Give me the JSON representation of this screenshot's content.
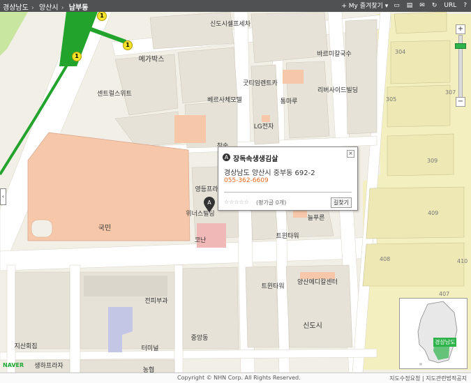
{
  "breadcrumb": {
    "items": [
      "경상남도",
      "양산시",
      "남부동"
    ]
  },
  "toolbar": {
    "my_favorites": "My 즐겨찾기",
    "url": "URL",
    "help": "?"
  },
  "colors": {
    "road": "#ffffff",
    "block": "#e6e2d8",
    "land": "#f2efe6",
    "highlight_block": "#f6c7a8",
    "selected_block": "#f1b8b8",
    "green_zone": "#c8e6a0",
    "subway": "#22a32c",
    "yellow_area": "#f4efbf"
  },
  "subway_badges": [
    "1",
    "1",
    "1"
  ],
  "labels": [
    {
      "text": "신도시셀프세차",
      "kind": "poi"
    },
    {
      "text": "메가박스",
      "kind": "poi"
    },
    {
      "text": "바르미칼국수",
      "kind": "poi"
    },
    {
      "text": "굿티임렌트카",
      "kind": "poi"
    },
    {
      "text": "센트럴스위트",
      "kind": "poi"
    },
    {
      "text": "베르사체모텔",
      "kind": "poi"
    },
    {
      "text": "통마루",
      "kind": "poi"
    },
    {
      "text": "리버사이드빌딩",
      "kind": "poi"
    },
    {
      "text": "LG전자",
      "kind": "poi"
    },
    {
      "text": "참숯",
      "kind": "poi"
    },
    {
      "text": "국민",
      "kind": "poi"
    },
    {
      "text": "영등프라",
      "kind": "poi"
    },
    {
      "text": "위너스빌딩",
      "kind": "poi"
    },
    {
      "text": "늘푸른",
      "kind": "poi"
    },
    {
      "text": "코난",
      "kind": "poi"
    },
    {
      "text": "트윈타워",
      "kind": "poi"
    },
    {
      "text": "트윈타워",
      "kind": "poi"
    },
    {
      "text": "양산메디칼센터",
      "kind": "poi"
    },
    {
      "text": "전피부과",
      "kind": "poi"
    },
    {
      "text": "터미널",
      "kind": "poi"
    },
    {
      "text": "중앙동",
      "kind": "poi"
    },
    {
      "text": "신도시",
      "kind": "poi"
    },
    {
      "text": "지산회집",
      "kind": "poi"
    },
    {
      "text": "생하프라자",
      "kind": "poi"
    },
    {
      "text": "농협",
      "kind": "poi"
    }
  ],
  "block_numbers": [
    "304",
    "305",
    "307",
    "309",
    "409",
    "408",
    "410",
    "407"
  ],
  "popup": {
    "pin": "A",
    "name": "장독속생생김살",
    "address": "경상남도 양산시 중부동 692-2",
    "phone": "055-362-6609",
    "stars": "☆☆☆☆☆",
    "reviews": "(평가글 0개)",
    "directions": "길찾기",
    "close": "×"
  },
  "marker": {
    "letter": "A"
  },
  "zoom": {
    "plus": "+",
    "minus": "−",
    "level": 0.15
  },
  "minimap": {
    "region": "경상남도"
  },
  "footer": {
    "copyright": "Copyright © NHN Corp. All Rights Reserved.",
    "links": "지도수정요청 | 지도관련법적공지"
  },
  "logo": "NAVER",
  "left_arrow": "‹"
}
